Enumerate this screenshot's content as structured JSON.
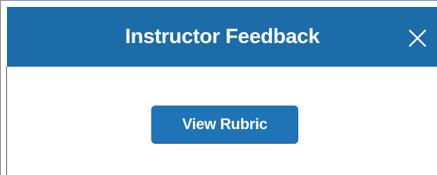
{
  "dialog": {
    "title": "Instructor Feedback",
    "close_icon": "close-icon",
    "header_color": "#1b6ca8"
  },
  "actions": {
    "view_rubric_label": "View Rubric",
    "button_color": "#1f73b7"
  }
}
